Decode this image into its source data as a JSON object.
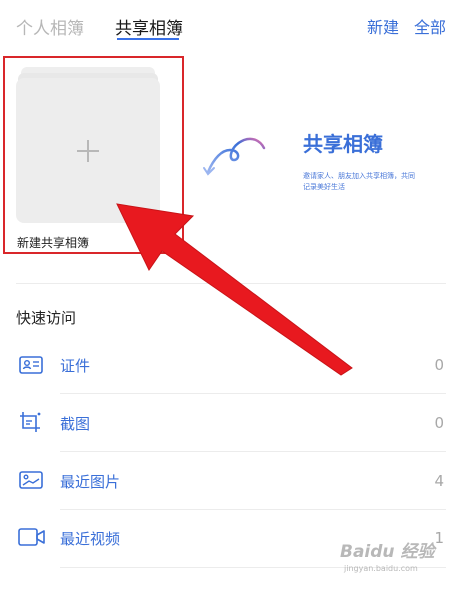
{
  "header": {
    "tabs": [
      {
        "label": "个人相簿",
        "active": false
      },
      {
        "label": "共享相簿",
        "active": true
      }
    ],
    "actions": {
      "new": "新建",
      "all": "全部"
    }
  },
  "album": {
    "label": "新建共享相簿",
    "plus": "+"
  },
  "promo": {
    "title": "共享相簿",
    "description": "邀请家人、朋友加入共享相簿，共同记录美好生活"
  },
  "quick_access": {
    "title": "快速访问",
    "items": [
      {
        "label": "证件",
        "count": "0",
        "icon": "id-card-icon"
      },
      {
        "label": "截图",
        "count": "0",
        "icon": "screenshot-icon"
      },
      {
        "label": "最近图片",
        "count": "4",
        "icon": "image-icon"
      },
      {
        "label": "最近视频",
        "count": "1",
        "icon": "video-icon"
      }
    ]
  },
  "watermark": {
    "main": "Baidu 经验",
    "sub": "jingyan.baidu.com"
  },
  "colors": {
    "accent": "#3a6fd8",
    "annotation_red": "#d9262a"
  }
}
